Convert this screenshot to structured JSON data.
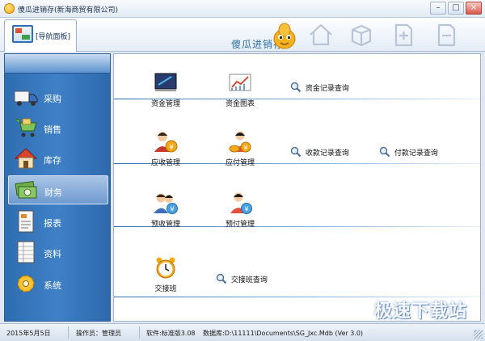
{
  "window": {
    "title": "傻瓜进销存(新海商贸有限公司)",
    "controls": [
      "–",
      "□",
      "×"
    ]
  },
  "toolbar": {
    "nav_tab_label": "[导航面板]",
    "brand_text": "傻瓜进销存",
    "buttons": [
      "home-icon",
      "cube-icon",
      "add-doc-icon",
      "remove-doc-icon"
    ]
  },
  "sidebar": {
    "items": [
      {
        "label": "采购",
        "icon": "truck-icon"
      },
      {
        "label": "销售",
        "icon": "cart-icon"
      },
      {
        "label": "库存",
        "icon": "house-icon"
      },
      {
        "label": "财务",
        "icon": "money-icon",
        "active": true
      },
      {
        "label": "报表",
        "icon": "report-icon"
      },
      {
        "label": "资料",
        "icon": "sheet-icon"
      },
      {
        "label": "系统",
        "icon": "gear-icon"
      }
    ]
  },
  "main": {
    "functions": [
      {
        "label": "资金管理",
        "icon": "ledger-icon"
      },
      {
        "label": "资金图表",
        "icon": "chart-icon"
      },
      {
        "label": "应收管理",
        "icon": "receivable-icon"
      },
      {
        "label": "应付管理",
        "icon": "payable-icon"
      },
      {
        "label": "预收管理",
        "icon": "prereceive-icon"
      },
      {
        "label": "预付管理",
        "icon": "prepay-icon"
      },
      {
        "label": "交接班",
        "icon": "clock-icon"
      }
    ],
    "queries": [
      {
        "label": "资金记录查询"
      },
      {
        "label": "收款记录查询"
      },
      {
        "label": "付款记录查询"
      },
      {
        "label": "交接班查询"
      }
    ]
  },
  "watermark": "极速下载站",
  "status": {
    "date": "2015年5月5日",
    "operator": "操作员：管理员",
    "software": "软件:标准版3.08",
    "database": "数据库:D:\\11111\\Documents\\SG_Jxc.Mdb (Ver 3.0)"
  },
  "colors": {
    "sidebar_blue": "#3f80c6",
    "accent_gold": "#f2a818",
    "divider_blue": "#2e6db3"
  }
}
